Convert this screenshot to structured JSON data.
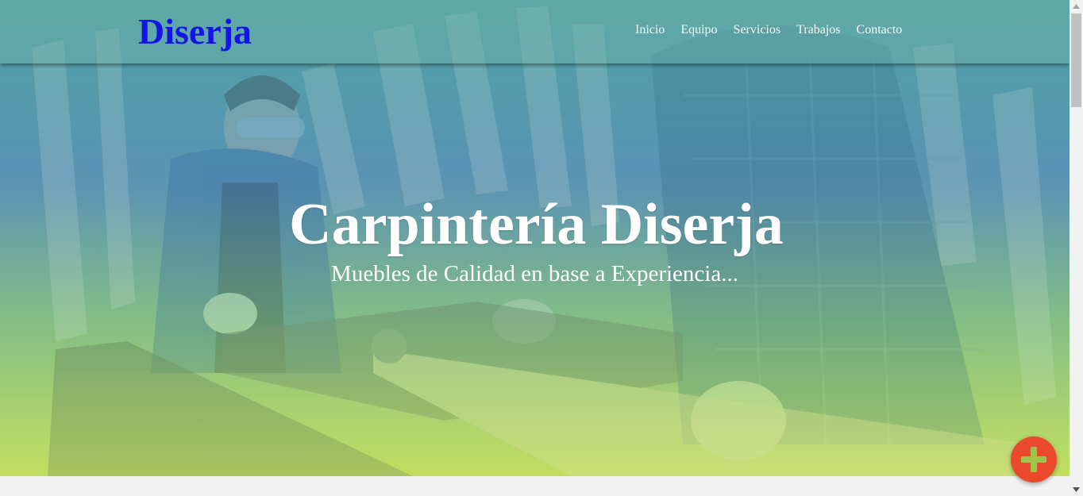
{
  "navbar": {
    "brand": "Diserja",
    "links": [
      "Inicio",
      "Equipo",
      "Servicios",
      "Trabajos",
      "Contacto"
    ]
  },
  "hero": {
    "title": "Carpintería Diserja",
    "subtitle": "Muebles de Calidad en base a Experiencia..."
  },
  "fab": {
    "icon": "plus-icon",
    "color": "#ea4a2b"
  },
  "colors": {
    "brand": "#1414e6",
    "nav_text": "#f4f8f4",
    "hero_text": "#ffffff"
  },
  "icons": {
    "fab": "plus-icon",
    "scroll_up": "arrow-up-icon",
    "scroll_down": "arrow-down-icon"
  }
}
